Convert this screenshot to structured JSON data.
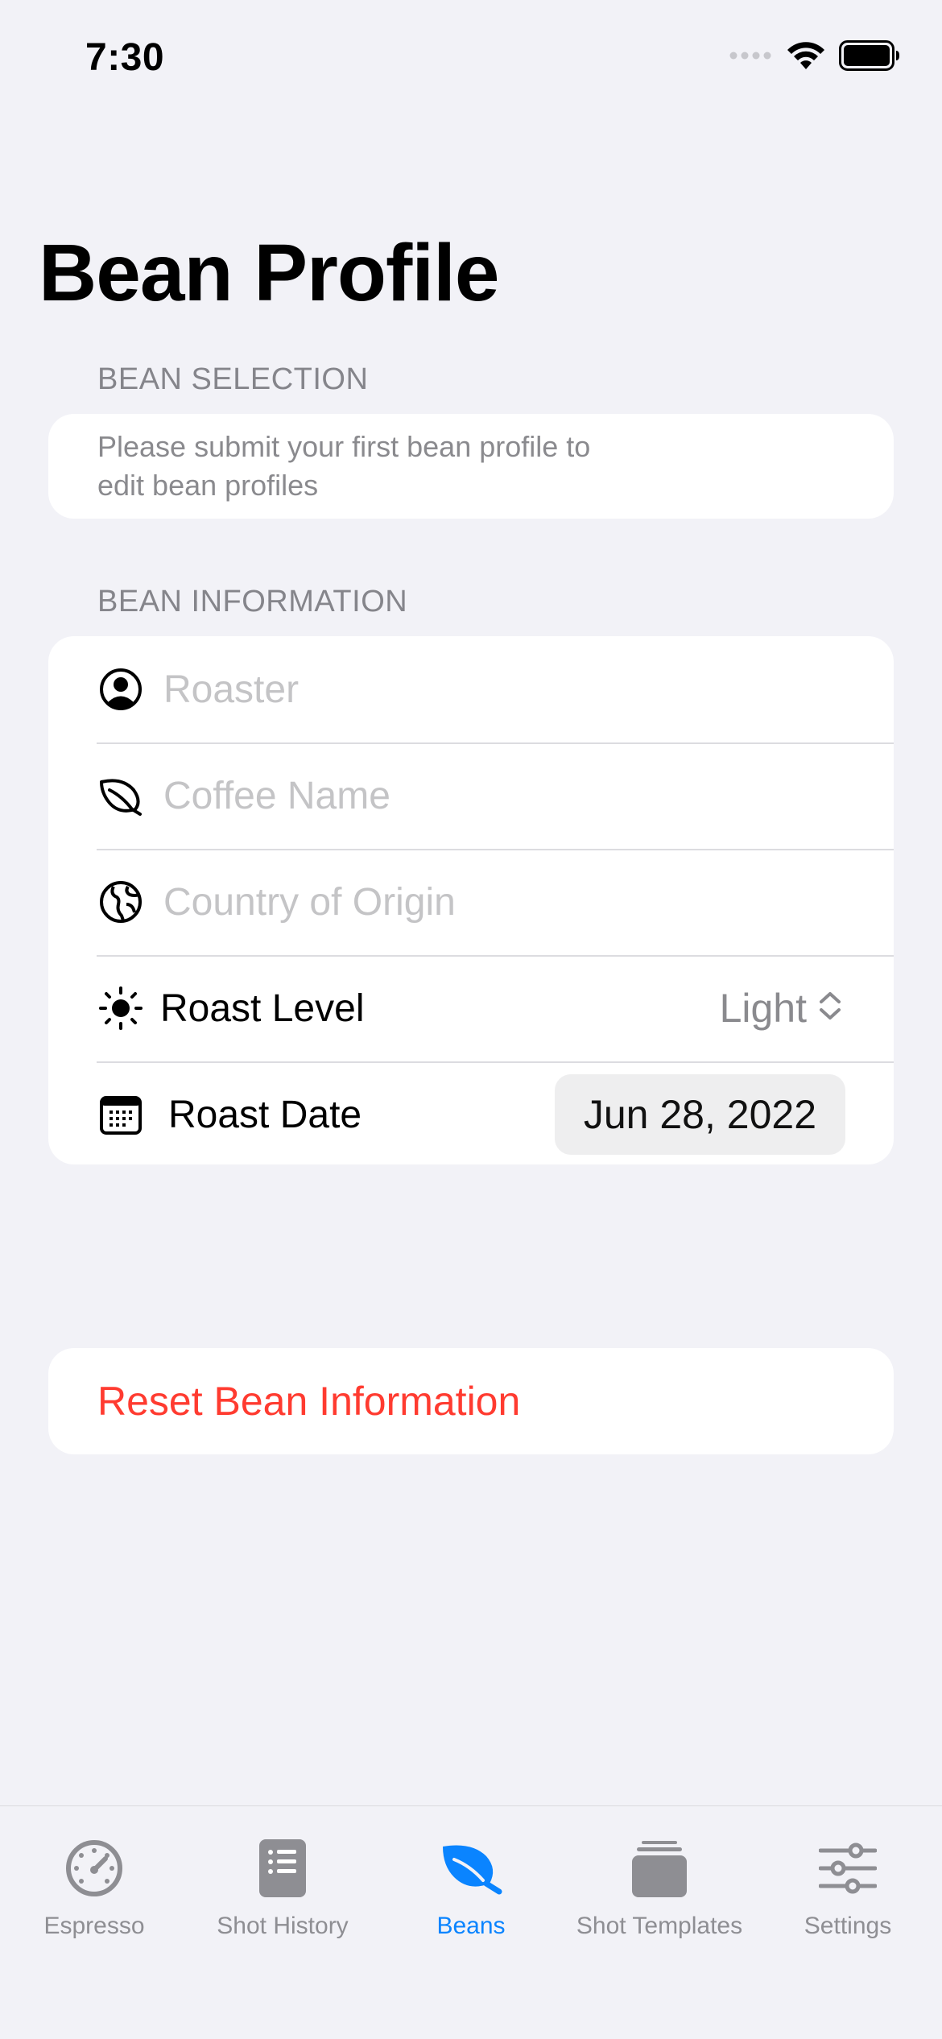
{
  "status": {
    "time": "7:30"
  },
  "title": "Bean Profile",
  "bean_selection": {
    "header": "BEAN SELECTION",
    "note": "Please submit your first bean profile to edit bean profiles"
  },
  "bean_information": {
    "header": "BEAN INFORMATION",
    "roaster": {
      "placeholder": "Roaster",
      "value": ""
    },
    "coffee_name": {
      "placeholder": "Coffee Name",
      "value": ""
    },
    "country": {
      "placeholder": "Country of Origin",
      "value": ""
    },
    "roast_level": {
      "label": "Roast Level",
      "value": "Light"
    },
    "roast_date": {
      "label": "Roast Date",
      "value": "Jun 28, 2022"
    }
  },
  "reset_label": "Reset Bean Information",
  "tabs": [
    {
      "label": "Espresso",
      "icon": "gauge-icon",
      "active": false
    },
    {
      "label": "Shot History",
      "icon": "list-icon",
      "active": false
    },
    {
      "label": "Beans",
      "icon": "leaf-icon",
      "active": true
    },
    {
      "label": "Shot Templates",
      "icon": "stack-icon",
      "active": false
    },
    {
      "label": "Settings",
      "icon": "sliders-icon",
      "active": false
    }
  ],
  "colors": {
    "accent": "#0a84ff",
    "destructive": "#ff3b30",
    "background": "#f2f2f7"
  }
}
